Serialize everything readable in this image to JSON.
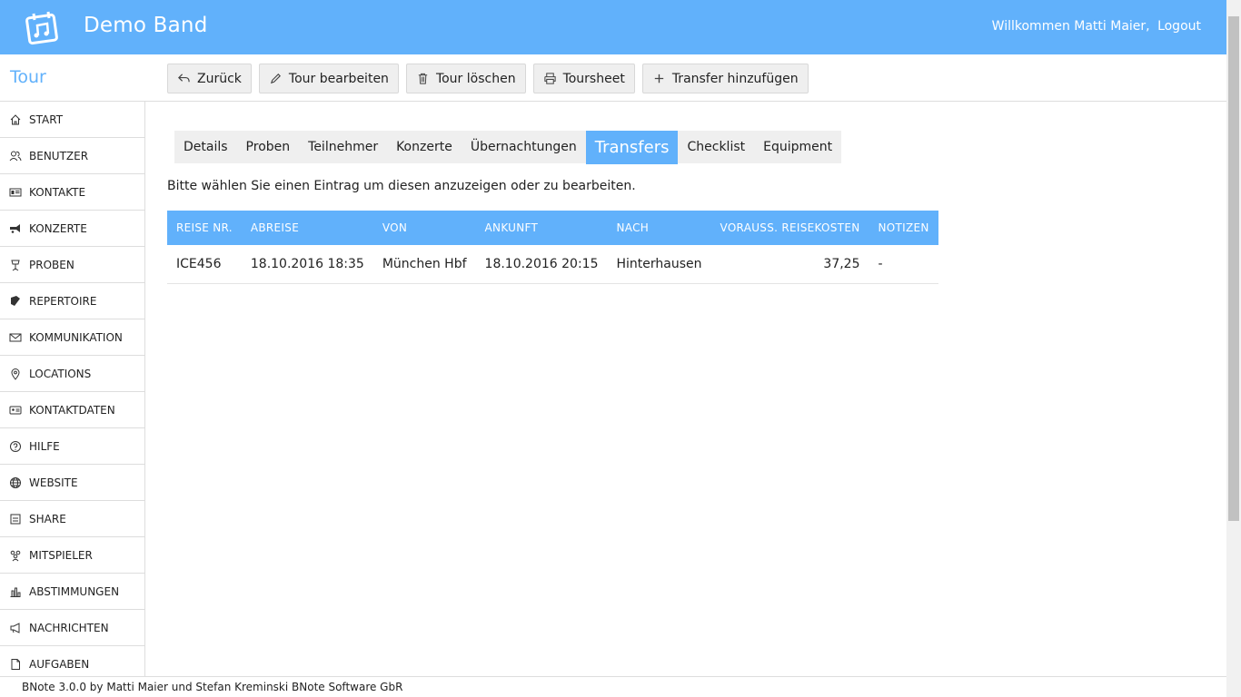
{
  "header": {
    "band_name": "Demo Band",
    "welcome": "Willkommen Matti Maier,",
    "logout": "Logout",
    "color": "#61b1fb"
  },
  "subheader": {
    "section_title": "Tour",
    "buttons": [
      {
        "label": "Zurück",
        "icon": "back-arrow-icon"
      },
      {
        "label": "Tour bearbeiten",
        "icon": "pencil-icon"
      },
      {
        "label": "Tour löschen",
        "icon": "trash-icon"
      },
      {
        "label": "Toursheet",
        "icon": "printer-icon"
      },
      {
        "label": "Transfer hinzufügen",
        "icon": "plus-icon"
      }
    ]
  },
  "sidebar": {
    "items": [
      {
        "label": "START",
        "icon": "home-icon"
      },
      {
        "label": "BENUTZER",
        "icon": "users-icon"
      },
      {
        "label": "KONTAKTE",
        "icon": "id-card-icon"
      },
      {
        "label": "KONZERTE",
        "icon": "trumpet-icon"
      },
      {
        "label": "PROBEN",
        "icon": "music-stand-icon"
      },
      {
        "label": "REPERTOIRE",
        "icon": "book-icon"
      },
      {
        "label": "KOMMUNIKATION",
        "icon": "envelope-icon"
      },
      {
        "label": "LOCATIONS",
        "icon": "map-pin-icon"
      },
      {
        "label": "KONTAKTDATEN",
        "icon": "contact-card-icon"
      },
      {
        "label": "HILFE",
        "icon": "question-icon"
      },
      {
        "label": "WEBSITE",
        "icon": "globe-icon"
      },
      {
        "label": "SHARE",
        "icon": "share-icon"
      },
      {
        "label": "MITSPIELER",
        "icon": "group-icon"
      },
      {
        "label": "ABSTIMMUNGEN",
        "icon": "chart-icon"
      },
      {
        "label": "NACHRICHTEN",
        "icon": "megaphone-icon"
      },
      {
        "label": "AUFGABEN",
        "icon": "task-icon"
      }
    ]
  },
  "tabs": [
    "Details",
    "Proben",
    "Teilnehmer",
    "Konzerte",
    "Übernachtungen",
    "Transfers",
    "Checklist",
    "Equipment"
  ],
  "active_tab": "Transfers",
  "hint": "Bitte wählen Sie einen Eintrag um diesen anzuzeigen oder zu bearbeiten.",
  "table": {
    "columns": [
      "REISE NR.",
      "ABREISE",
      "VON",
      "ANKUNFT",
      "NACH",
      "VORAUSS. REISEKOSTEN",
      "NOTIZEN"
    ],
    "rows": [
      [
        "ICE456",
        "18.10.2016 18:35",
        "München Hbf",
        "18.10.2016 20:15",
        "Hinterhausen",
        "37,25",
        "-"
      ]
    ]
  },
  "footer": {
    "text": "BNote 3.0.0 by Matti Maier und Stefan Kreminski BNote Software GbR"
  }
}
